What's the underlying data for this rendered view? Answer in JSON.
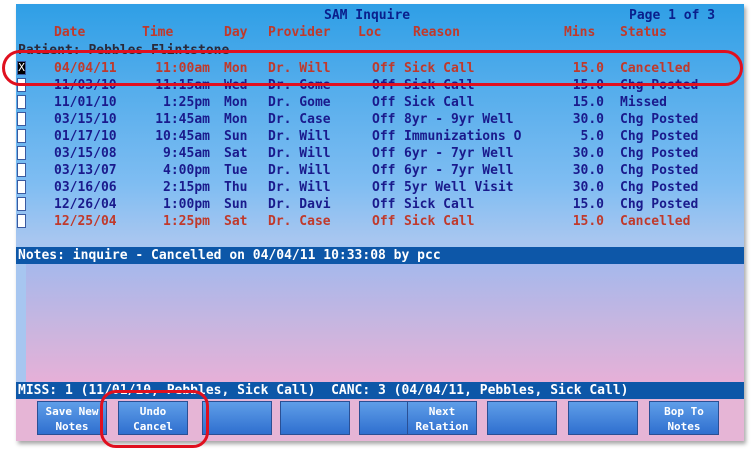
{
  "header": {
    "title": "SAM Inquire",
    "page": "Page 1 of 3"
  },
  "columns": {
    "date": "Date",
    "time": "Time",
    "day": "Day",
    "provider": "Provider",
    "loc": "Loc",
    "reason": "Reason",
    "mins": "Mins",
    "status": "Status"
  },
  "patient_line": "Patient: Pebbles Flintstone",
  "rows": [
    {
      "checked": "X",
      "date": "04/04/11",
      "time": "11:00am",
      "day": "Mon",
      "provider": "Dr. Will",
      "loc": "Off",
      "reason": "Sick Call",
      "mins": "15.0",
      "status": "Cancelled"
    },
    {
      "checked": "",
      "date": "11/03/10",
      "time": "11:15am",
      "day": "Wed",
      "provider": "Dr. Gome",
      "loc": "Off",
      "reason": "Sick Call",
      "mins": "15.0",
      "status": "Chg Posted"
    },
    {
      "checked": "",
      "date": "11/01/10",
      "time": "1:25pm",
      "day": "Mon",
      "provider": "Dr. Gome",
      "loc": "Off",
      "reason": "Sick Call",
      "mins": "15.0",
      "status": "Missed"
    },
    {
      "checked": "",
      "date": "03/15/10",
      "time": "11:45am",
      "day": "Mon",
      "provider": "Dr. Case",
      "loc": "Off",
      "reason": "8yr - 9yr Well",
      "mins": "30.0",
      "status": "Chg Posted"
    },
    {
      "checked": "",
      "date": "01/17/10",
      "time": "10:45am",
      "day": "Sun",
      "provider": "Dr. Will",
      "loc": "Off",
      "reason": "Immunizations O",
      "mins": "5.0",
      "status": "Chg Posted"
    },
    {
      "checked": "",
      "date": "03/15/08",
      "time": "9:45am",
      "day": "Sat",
      "provider": "Dr. Will",
      "loc": "Off",
      "reason": "6yr - 7yr Well",
      "mins": "30.0",
      "status": "Chg Posted"
    },
    {
      "checked": "",
      "date": "03/13/07",
      "time": "4:00pm",
      "day": "Tue",
      "provider": "Dr. Will",
      "loc": "Off",
      "reason": "6yr - 7yr Well",
      "mins": "30.0",
      "status": "Chg Posted"
    },
    {
      "checked": "",
      "date": "03/16/06",
      "time": "2:15pm",
      "day": "Thu",
      "provider": "Dr. Will",
      "loc": "Off",
      "reason": "5yr Well Visit",
      "mins": "30.0",
      "status": "Chg Posted"
    },
    {
      "checked": "",
      "date": "12/26/04",
      "time": "1:00pm",
      "day": "Sun",
      "provider": "Dr. Davi",
      "loc": "Off",
      "reason": "Sick Call",
      "mins": "15.0",
      "status": "Chg Posted"
    },
    {
      "checked": "",
      "date": "12/25/04",
      "time": "1:25pm",
      "day": "Sat",
      "provider": "Dr. Case",
      "loc": "Off",
      "reason": "Sick Call",
      "mins": "15.0",
      "status": "Cancelled"
    }
  ],
  "notes_header": "Notes: inquire - Cancelled on 04/04/11 10:33:08 by pcc",
  "notes_body": "",
  "summary": "MISS: 1 (11/01/10, Pebbles, Sick Call)  CANC: 3 (04/04/11, Pebbles, Sick Call)",
  "fkeys": [
    {
      "line1": "Save New",
      "line2": "Notes"
    },
    {
      "line1": "Undo",
      "line2": "Cancel"
    },
    {
      "line1": "",
      "line2": ""
    },
    {
      "line1": "",
      "line2": ""
    },
    {
      "line1": "",
      "line2": ""
    },
    {
      "line1": "Next",
      "line2": "Relation"
    },
    {
      "line1": "",
      "line2": ""
    },
    {
      "line1": "",
      "line2": ""
    },
    {
      "line1": "Bop To",
      "line2": "Notes"
    }
  ],
  "colors": {
    "annotation": "#e0101f",
    "cancelled": "#c0392b",
    "normal": "#1a1a8c",
    "notes_bar": "#0d57a8"
  }
}
